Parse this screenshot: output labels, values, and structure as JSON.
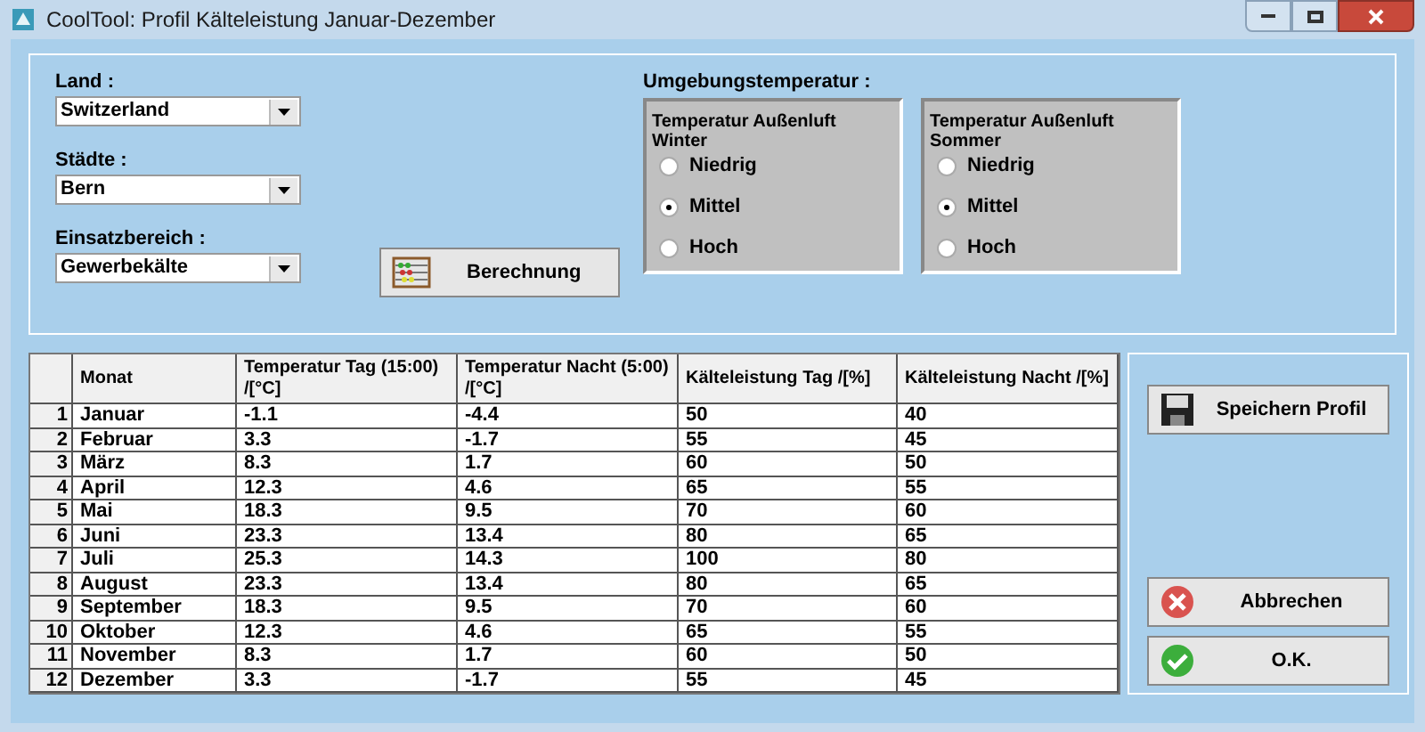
{
  "window": {
    "title": "CoolTool: Profil Kälteleistung Januar-Dezember"
  },
  "fields": [
    {
      "label": "Land :",
      "value": "Switzerland"
    },
    {
      "label": "Städte :",
      "value": "Bern"
    },
    {
      "label": "Einsatzbereich :",
      "value": "Gewerbekälte"
    }
  ],
  "calculate_button": "Berechnung",
  "ambient": {
    "label": "Umgebungstemperatur :",
    "groups": [
      {
        "title": "Temperatur Außenluft Winter",
        "options": [
          {
            "label": "Niedrig",
            "selected": false
          },
          {
            "label": "Mittel",
            "selected": true
          },
          {
            "label": "Hoch",
            "selected": false
          }
        ]
      },
      {
        "title": "Temperatur Außenluft Sommer",
        "options": [
          {
            "label": "Niedrig",
            "selected": false
          },
          {
            "label": "Mittel",
            "selected": true
          },
          {
            "label": "Hoch",
            "selected": false
          }
        ]
      }
    ]
  },
  "table": {
    "columns": [
      "",
      "Monat",
      "Temperatur Tag (15:00) /[°C]",
      "Temperatur Nacht (5:00) /[°C]",
      "Kälteleistung Tag /[%]",
      "Kälteleistung Nacht /[%]"
    ],
    "rows": [
      [
        "1",
        "Januar",
        "-1.1",
        "-4.4",
        "50",
        "40"
      ],
      [
        "2",
        "Februar",
        "3.3",
        "-1.7",
        "55",
        "45"
      ],
      [
        "3",
        "März",
        "8.3",
        "1.7",
        "60",
        "50"
      ],
      [
        "4",
        "April",
        "12.3",
        "4.6",
        "65",
        "55"
      ],
      [
        "5",
        "Mai",
        "18.3",
        "9.5",
        "70",
        "60"
      ],
      [
        "6",
        "Juni",
        "23.3",
        "13.4",
        "80",
        "65"
      ],
      [
        "7",
        "Juli",
        "25.3",
        "14.3",
        "100",
        "80"
      ],
      [
        "8",
        "August",
        "23.3",
        "13.4",
        "80",
        "65"
      ],
      [
        "9",
        "September",
        "18.3",
        "9.5",
        "70",
        "60"
      ],
      [
        "10",
        "Oktober",
        "12.3",
        "4.6",
        "65",
        "55"
      ],
      [
        "11",
        "November",
        "8.3",
        "1.7",
        "60",
        "50"
      ],
      [
        "12",
        "Dezember",
        "3.3",
        "-1.7",
        "55",
        "45"
      ]
    ]
  },
  "buttons": [
    {
      "kind": "save",
      "label": "Speichern Profil"
    },
    {
      "kind": "cancel",
      "label": "Abbrechen"
    },
    {
      "kind": "ok",
      "label": "O.K."
    }
  ]
}
